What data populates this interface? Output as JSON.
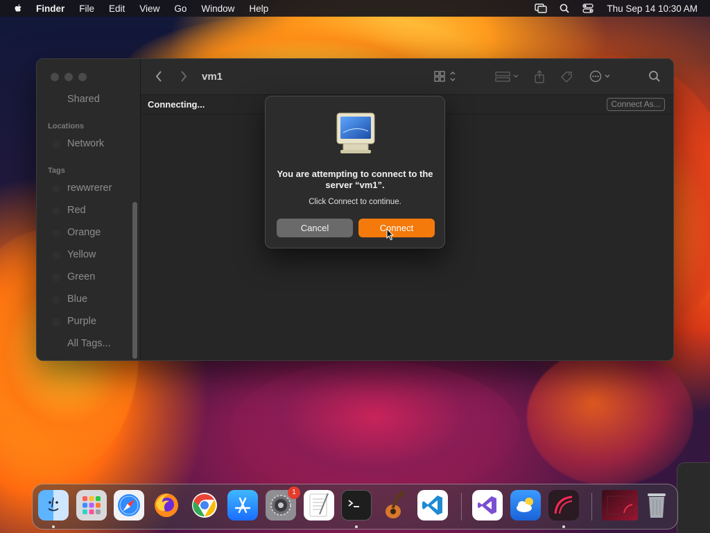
{
  "menubar": {
    "app_name": "Finder",
    "menus": [
      "File",
      "Edit",
      "View",
      "Go",
      "Window",
      "Help"
    ],
    "clock": "Thu Sep 14  10:30 AM"
  },
  "finder": {
    "title": "vm1",
    "status": "Connecting...",
    "connect_as_label": "Connect As...",
    "sidebar": {
      "shared_label": "Shared",
      "locations_header": "Locations",
      "network_label": "Network",
      "tags_header": "Tags",
      "tags": [
        "rewwrerer",
        "Red",
        "Orange",
        "Yellow",
        "Green",
        "Blue",
        "Purple"
      ],
      "all_tags_label": "All Tags..."
    }
  },
  "dialog": {
    "title": "You are attempting to connect to the server “vm1”.",
    "message": "Click Connect to continue.",
    "cancel_label": "Cancel",
    "connect_label": "Connect",
    "accent_color": "#f47a0c"
  },
  "dock": {
    "apps": [
      "finder-icon",
      "launchpad-icon",
      "safari-icon",
      "firefox-icon",
      "chrome-icon",
      "app-store-icon",
      "system-settings-icon",
      "textedit-icon",
      "terminal-icon",
      "garageband-icon",
      "vscode-icon",
      "visual-studio-icon",
      "weather-icon",
      "screenshot-app-icon",
      "recent-window-icon",
      "trash-icon"
    ],
    "settings_badge": "1"
  }
}
